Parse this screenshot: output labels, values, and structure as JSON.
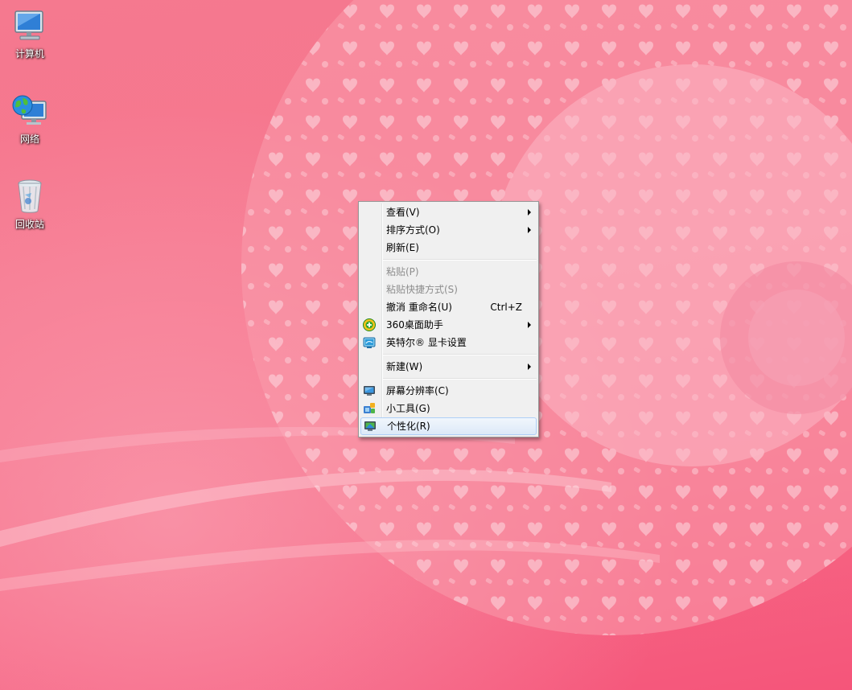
{
  "desktop": {
    "icons": [
      {
        "label": "计算机",
        "icon": "computer-icon"
      },
      {
        "label": "网络",
        "icon": "network-icon"
      },
      {
        "label": "回收站",
        "icon": "recycle-bin-icon"
      }
    ]
  },
  "context_menu": {
    "items": [
      {
        "label": "查看(V)",
        "submenu": true
      },
      {
        "label": "排序方式(O)",
        "submenu": true
      },
      {
        "label": "刷新(E)"
      },
      {
        "label": "粘贴(P)",
        "disabled": true
      },
      {
        "label": "粘贴快捷方式(S)",
        "disabled": true
      },
      {
        "label": "撤消 重命名(U)",
        "shortcut": "Ctrl+Z"
      },
      {
        "label": "360桌面助手",
        "submenu": true,
        "icon": "360-assistant-icon"
      },
      {
        "label": "英特尔® 显卡设置",
        "icon": "intel-graphics-icon"
      },
      {
        "label": "新建(W)",
        "submenu": true
      },
      {
        "label": "屏幕分辨率(C)",
        "icon": "monitor-icon"
      },
      {
        "label": "小工具(G)",
        "icon": "gadgets-icon"
      },
      {
        "label": "个性化(R)",
        "icon": "personalize-icon",
        "highlighted": true
      }
    ]
  },
  "colors": {
    "wallpaper_base": "#f6768e",
    "lace": "#fbb3c2",
    "menu_bg": "#f0f0f0",
    "menu_hover": "#dce9f8"
  }
}
